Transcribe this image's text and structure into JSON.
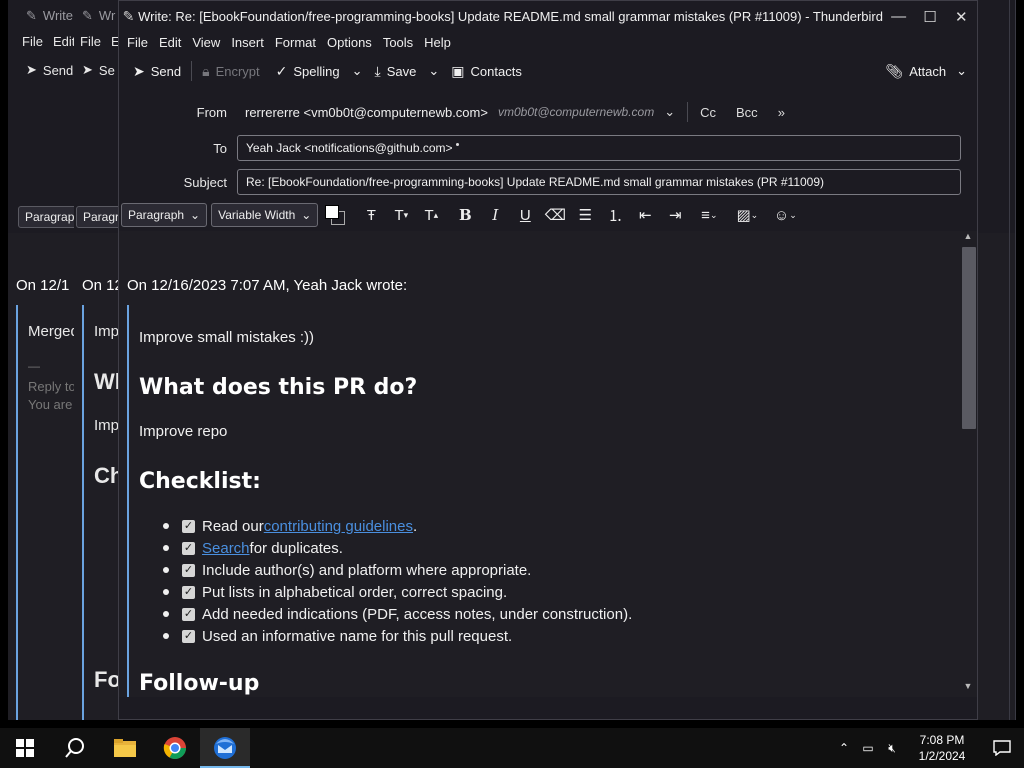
{
  "main_window": {
    "title": "Write: Re: [EbookFoundation/free-programming-books] Update README.md small grammar mistakes (PR #11009) - Thunderbird",
    "menu": [
      "File",
      "Edit",
      "View",
      "Insert",
      "Format",
      "Options",
      "Tools",
      "Help"
    ],
    "toolbar": {
      "send": "Send",
      "encrypt": "Encrypt",
      "spelling": "Spelling",
      "save": "Save",
      "contacts": "Contacts",
      "attach": "Attach"
    },
    "from_label": "From",
    "from_value": "rerrererre <vm0b0t@computernewb.com>",
    "from_identity": "vm0b0t@computernewb.com",
    "cc": "Cc",
    "bcc": "Bcc",
    "to_label": "To",
    "to_value": "Yeah Jack <notifications@github.com>",
    "subject_label": "Subject",
    "subject_value": "Re: [EbookFoundation/free-programming-books] Update README.md small grammar mistakes (PR #11009)",
    "paragraph_format": "Paragraph",
    "font": "Variable Width",
    "body": {
      "wrote_line": "On 12/16/2023 7:07 AM, Yeah Jack wrote:",
      "intro": "Improve small mistakes :))",
      "h_what": "What does this PR do?",
      "what_text": "Improve repo",
      "h_checklist": "Checklist:",
      "checklist": [
        {
          "pre": "Read our ",
          "link": "contributing guidelines",
          "post": "."
        },
        {
          "pre": "",
          "link": "Search",
          "post": " for duplicates."
        },
        {
          "pre": "Include author(s) and platform where appropriate.",
          "link": "",
          "post": ""
        },
        {
          "pre": "Put lists in alphabetical order, correct spacing.",
          "link": "",
          "post": ""
        },
        {
          "pre": "Add needed indications (PDF, access notes, under construction).",
          "link": "",
          "post": ""
        },
        {
          "pre": "Used an informative name for this pull request.",
          "link": "",
          "post": ""
        }
      ],
      "h_followup": "Follow-up"
    }
  },
  "background_windows": [
    {
      "title": "Write: R",
      "menu_file": "File",
      "menu_edit": "Edit",
      "send": "Send",
      "paragraph": "Paragraph",
      "wrote": "On 12/1",
      "line1": "Merged",
      "line2": "—",
      "line3": "Reply to",
      "line4": "You are"
    },
    {
      "title": "Wr",
      "menu_file": "File",
      "menu_edit": "E",
      "send": "Se",
      "paragraph": "Paragr",
      "wrote": "On 12",
      "line1": "Imp",
      "line2": "Wh",
      "line3": "Imp",
      "line4": "Ch",
      "line5": "Fo"
    }
  ],
  "taskbar": {
    "time": "7:08 PM",
    "date": "1/2/2024",
    "apps": [
      "start-button",
      "search-button",
      "file-explorer",
      "chrome",
      "thunderbird"
    ]
  },
  "colors": {
    "accent": "#76b9ed",
    "link": "#4a8fdf",
    "quote_bar": "#6aa3e0"
  }
}
